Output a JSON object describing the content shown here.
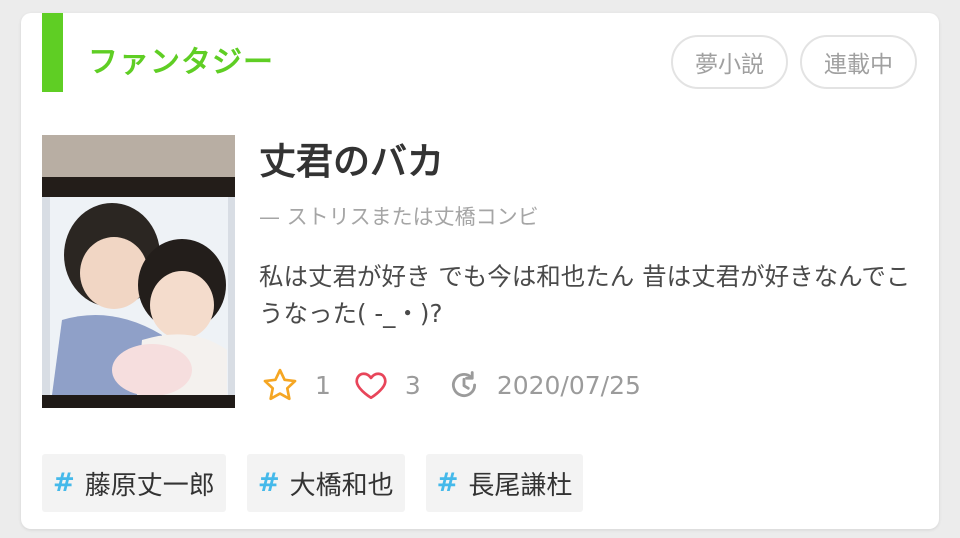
{
  "genre": {
    "label": "ファンタジー",
    "color": "#5fce24"
  },
  "badges": [
    {
      "label": "夢小説"
    },
    {
      "label": "連載中"
    }
  ],
  "thumbnail": {
    "icon": "cover-image"
  },
  "story": {
    "title": "丈君のバカ",
    "subtitle": "— ストリスまたは丈橋コンビ",
    "description": "私は丈君が好き でも今は和也たん 昔は丈君が好きなんでこうなった( -_・)?"
  },
  "stats": {
    "stars": "1",
    "likes": "3",
    "updated": "2020/07/25",
    "star_color": "#f5a623",
    "heart_color": "#e8455a"
  },
  "tags": [
    {
      "hash": "#",
      "label": "藤原丈一郎"
    },
    {
      "hash": "#",
      "label": "大橋和也"
    },
    {
      "hash": "#",
      "label": "長尾謙杜"
    }
  ]
}
